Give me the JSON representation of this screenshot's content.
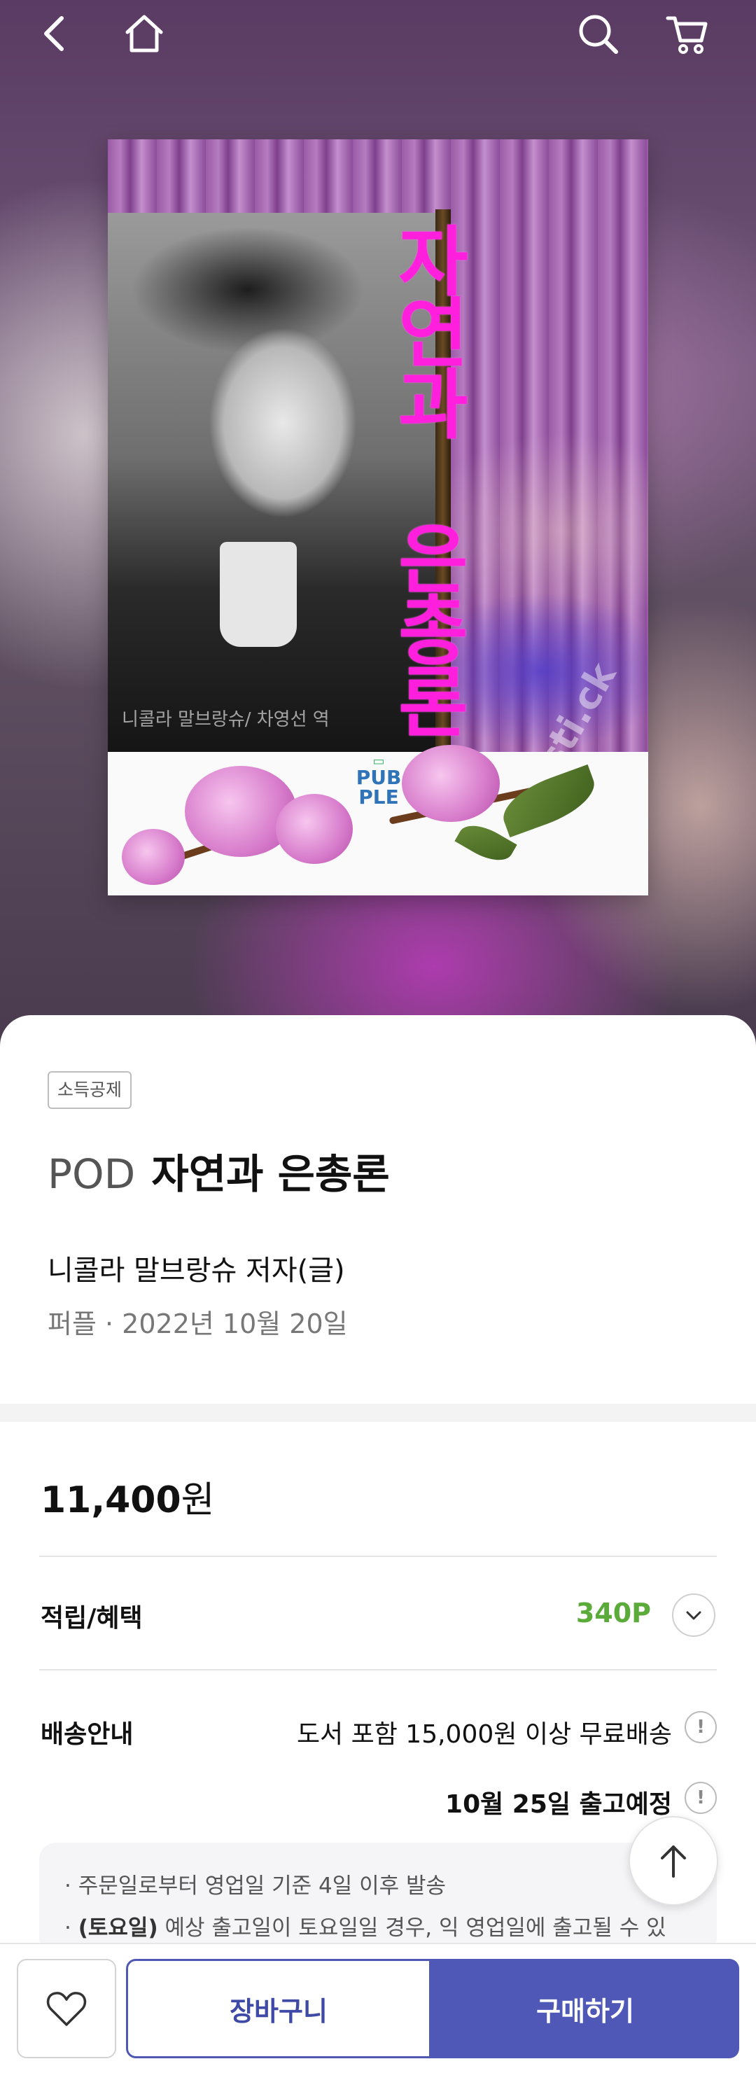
{
  "header": {
    "back_icon": "chevron-left-icon",
    "home_icon": "home-icon",
    "search_icon": "search-icon",
    "cart_icon": "cart-icon"
  },
  "cover": {
    "title": "자연과 은총론",
    "author_line": "니콜라 말브랑슈/ 차영선 역",
    "watermark": "ersti.ck",
    "publisher_logo": "PUB PLE"
  },
  "product": {
    "badge": "소득공제",
    "title_prefix": "POD",
    "title": "자연과 은총론",
    "author": "니콜라 말브랑슈 저자(글)",
    "publisher_date": "퍼플 · 2022년 10월 20일",
    "price_number": "11,400",
    "price_unit": "원"
  },
  "benefit": {
    "label": "적립/혜택",
    "points": "340P"
  },
  "shipping": {
    "label": "배송안내",
    "free_shipping": "도서 포함 15,000원 이상 무료배송",
    "release": "10월 25일 출고예정",
    "notices": [
      {
        "bullet": "·",
        "bold": "",
        "text": "주문일로부터 영업일 기준 4일 이후 발송"
      },
      {
        "bullet": "·",
        "bold": "(토요일)",
        "text": " 예상 출고일이 토요일일 경우, 익 영업일에 출고될 수 있"
      }
    ]
  },
  "actions": {
    "wishlist_icon": "heart-icon",
    "cart_label": "장바구니",
    "buy_label": "구매하기",
    "scroll_top_icon": "arrow-up-icon"
  },
  "colors": {
    "accent": "#5058b7",
    "points_green": "#5aab3a",
    "cover_title_magenta": "#ff1fdc"
  }
}
